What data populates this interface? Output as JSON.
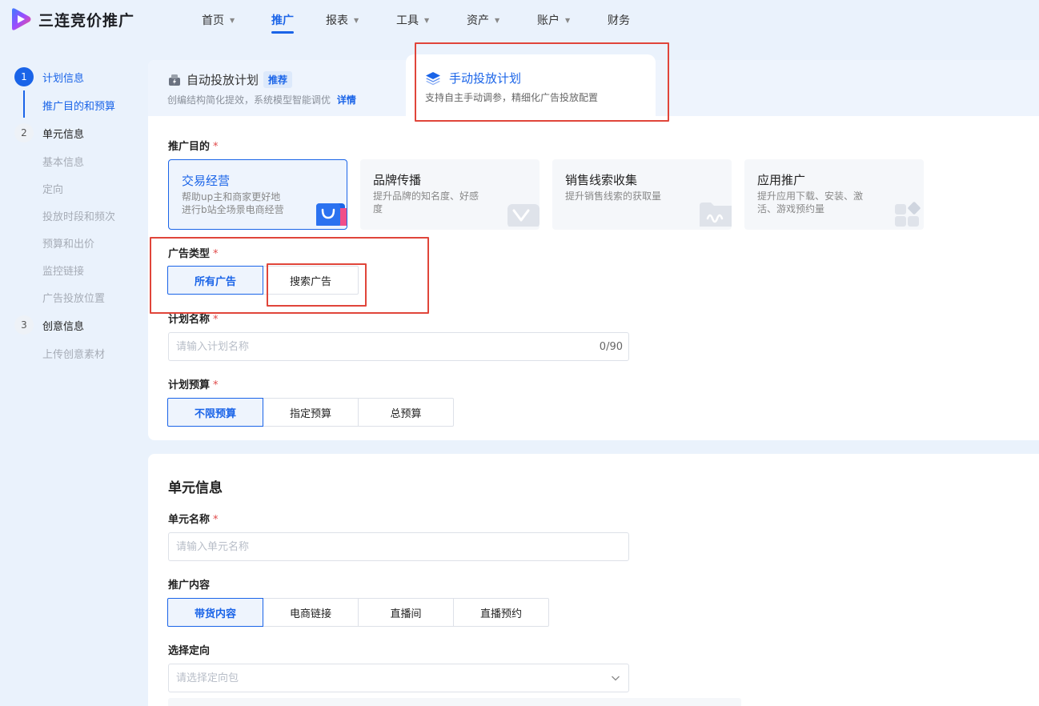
{
  "app": {
    "title": "三连竞价推广"
  },
  "nav": {
    "items": [
      {
        "label": "首页",
        "caret": true
      },
      {
        "label": "推广",
        "caret": false,
        "active": true
      },
      {
        "label": "报表",
        "caret": true
      },
      {
        "label": "工具",
        "caret": true
      },
      {
        "label": "资产",
        "caret": true
      },
      {
        "label": "账户",
        "caret": true
      },
      {
        "label": "财务",
        "caret": false
      }
    ]
  },
  "steps": {
    "s1": {
      "num": "1",
      "label": "计划信息"
    },
    "s1_sub": [
      "推广目的和预算"
    ],
    "s2": {
      "num": "2",
      "label": "单元信息"
    },
    "s2_sub": [
      "基本信息",
      "定向",
      "投放时段和频次",
      "预算和出价",
      "监控链接",
      "广告投放位置"
    ],
    "s3": {
      "num": "3",
      "label": "创意信息"
    },
    "s3_sub": [
      "上传创意素材"
    ]
  },
  "plan_types": {
    "auto": {
      "title": "自动投放计划",
      "badge": "推荐",
      "desc": "创编结构简化提效，系统模型智能调优",
      "link": "详情"
    },
    "manual": {
      "title": "手动投放计划",
      "desc": "支持自主手动调参，精细化广告投放配置"
    }
  },
  "goal": {
    "label": "推广目的",
    "options": [
      {
        "title": "交易经营",
        "desc": "帮助up主和商家更好地进行b站全场景电商经营"
      },
      {
        "title": "品牌传播",
        "desc": "提升品牌的知名度、好感度"
      },
      {
        "title": "销售线索收集",
        "desc": "提升销售线索的获取量"
      },
      {
        "title": "应用推广",
        "desc": "提升应用下载、安装、激活、游戏预约量"
      }
    ]
  },
  "ad_type": {
    "label": "广告类型",
    "options": [
      "所有广告",
      "搜索广告"
    ]
  },
  "plan_name": {
    "label": "计划名称",
    "placeholder": "请输入计划名称",
    "counter": "0/90"
  },
  "plan_budget": {
    "label": "计划预算",
    "options": [
      "不限预算",
      "指定预算",
      "总预算"
    ]
  },
  "unit": {
    "title": "单元信息",
    "name": {
      "label": "单元名称",
      "placeholder": "请输入单元名称"
    },
    "content": {
      "label": "推广内容",
      "options": [
        "带货内容",
        "电商链接",
        "直播间",
        "直播预约"
      ]
    },
    "targeting": {
      "label": "选择定向",
      "placeholder": "请选择定向包"
    }
  },
  "colors": {
    "accent": "#1a64e8",
    "annotation": "#e0453a",
    "required": "#e04a4a"
  }
}
